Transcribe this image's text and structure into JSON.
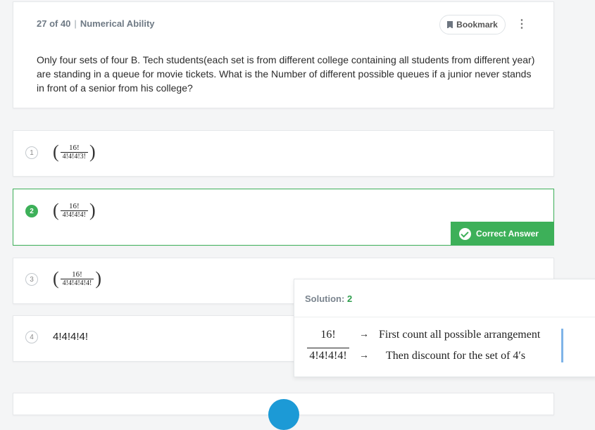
{
  "question": {
    "position": "27 of 40",
    "separator": "|",
    "category": "Numerical Ability",
    "bookmark_label": "Bookmark",
    "more_icon": "⋮",
    "text": "Only four sets of four B. Tech students(each set is from different college containing all students from different year) are standing in a queue for movie tickets. What is the Number of different possible queues if a junior never stands in front of a senior from his college?"
  },
  "options": [
    {
      "number": "1",
      "numerator": "16!",
      "denominator": "4!4!4!3!",
      "paren_open": "(",
      "paren_close": ")"
    },
    {
      "number": "2",
      "numerator": "16!",
      "denominator": "4!4!4!4!",
      "paren_open": "(",
      "paren_close": ")",
      "selected": true
    },
    {
      "number": "3",
      "numerator": "16!",
      "denominator": "4!4!4!4!4!",
      "paren_open": "(",
      "paren_close": ")"
    },
    {
      "number": "4",
      "text": "4!4!4!4!"
    }
  ],
  "correct_badge": "Correct Answer",
  "solution": {
    "label": "Solution:",
    "value": "2",
    "numerator": "16!",
    "denominator": "4!4!4!4!",
    "arrow": "→",
    "line1": "First count all possible arrangement",
    "line2": "Then discount for the set of 4′s"
  },
  "colors": {
    "accent_green": "#3db059",
    "fab_blue": "#1c9ad6"
  }
}
